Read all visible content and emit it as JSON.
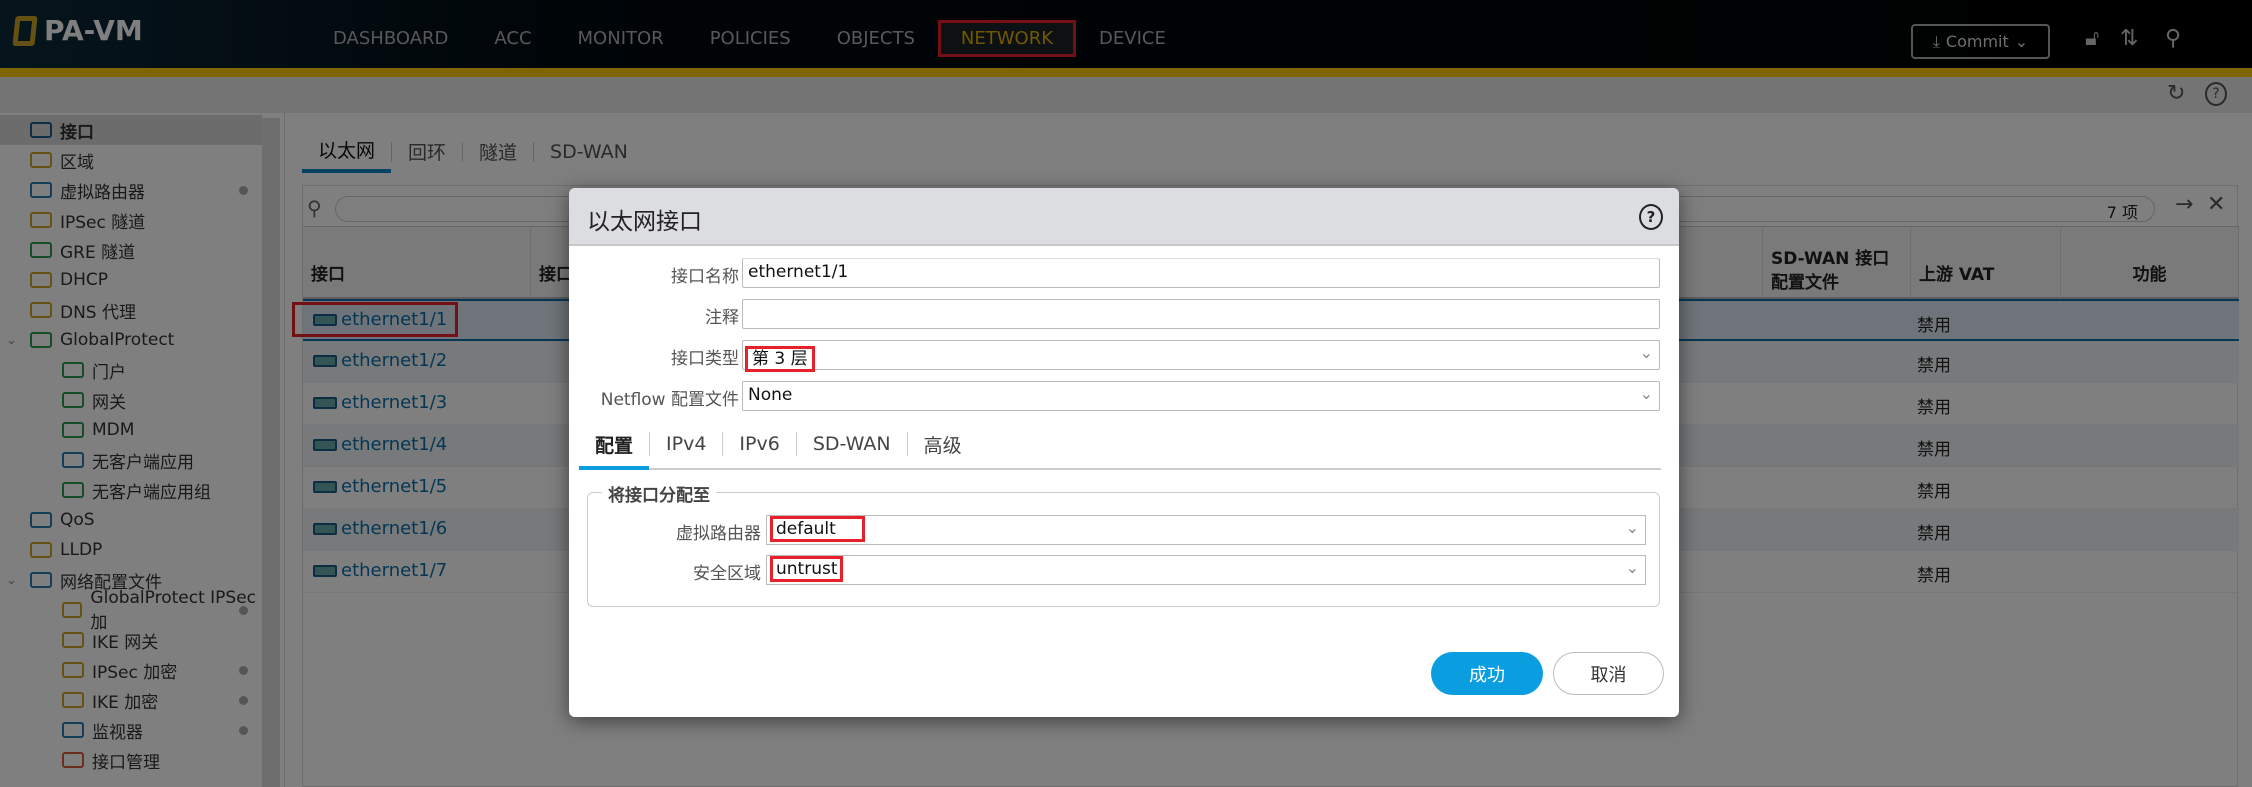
{
  "app": {
    "logo": "PA-VM"
  },
  "nav": [
    "DASHBOARD",
    "ACC",
    "MONITOR",
    "POLICIES",
    "OBJECTS",
    "NETWORK",
    "DEVICE"
  ],
  "nav_active": "NETWORK",
  "header": {
    "commit_label": "Commit"
  },
  "sidebar": {
    "items": [
      {
        "label": "接口",
        "icon": "interface-icon",
        "selected": true
      },
      {
        "label": "区域",
        "icon": "zone-icon"
      },
      {
        "label": "虚拟路由器",
        "icon": "router-icon",
        "dot": true
      },
      {
        "label": "IPSec 隧道",
        "icon": "ipsec-tunnel-icon"
      },
      {
        "label": "GRE 隧道",
        "icon": "gre-tunnel-icon"
      },
      {
        "label": "DHCP",
        "icon": "dhcp-icon"
      },
      {
        "label": "DNS 代理",
        "icon": "dns-proxy-icon"
      },
      {
        "label": "GlobalProtect",
        "icon": "globalprotect-icon",
        "expanded": true
      },
      {
        "label": "门户",
        "icon": "portal-icon",
        "indent": 1
      },
      {
        "label": "网关",
        "icon": "gateway-icon",
        "indent": 1
      },
      {
        "label": "MDM",
        "icon": "mdm-icon",
        "indent": 1
      },
      {
        "label": "无客户端应用",
        "icon": "clientless-app-icon",
        "indent": 1
      },
      {
        "label": "无客户端应用组",
        "icon": "clientless-app-group-icon",
        "indent": 1
      },
      {
        "label": "QoS",
        "icon": "qos-icon"
      },
      {
        "label": "LLDP",
        "icon": "lldp-icon"
      },
      {
        "label": "网络配置文件",
        "icon": "network-profiles-icon",
        "expanded": true
      },
      {
        "label": "GlobalProtect IPSec 加",
        "icon": "lock-icon",
        "indent": 1,
        "dot": true
      },
      {
        "label": "IKE 网关",
        "icon": "ike-gateway-icon",
        "indent": 1
      },
      {
        "label": "IPSec 加密",
        "icon": "lock-icon",
        "indent": 1,
        "dot": true
      },
      {
        "label": "IKE 加密",
        "icon": "lock-icon",
        "indent": 1,
        "dot": true
      },
      {
        "label": "监视器",
        "icon": "monitor-icon",
        "indent": 1,
        "dot": true
      },
      {
        "label": "接口管理",
        "icon": "interface-mgmt-icon",
        "indent": 1
      }
    ]
  },
  "tabs": [
    "以太网",
    "回环",
    "隧道",
    "SD-WAN"
  ],
  "table": {
    "count": "7 项",
    "columns": [
      "接口",
      "接口",
      "SD-WAN 接口配置文件",
      "上游 VAT",
      "功能"
    ],
    "rows": [
      {
        "iface": "ethernet1/1",
        "vat": "禁用"
      },
      {
        "iface": "ethernet1/2",
        "vat": "禁用"
      },
      {
        "iface": "ethernet1/3",
        "vat": "禁用"
      },
      {
        "iface": "ethernet1/4",
        "vat": "禁用"
      },
      {
        "iface": "ethernet1/5",
        "vat": "禁用"
      },
      {
        "iface": "ethernet1/6",
        "vat": "禁用"
      },
      {
        "iface": "ethernet1/7",
        "vat": "禁用"
      }
    ]
  },
  "dialog": {
    "title": "以太网接口",
    "fields": {
      "name_label": "接口名称",
      "name_value": "ethernet1/1",
      "comment_label": "注释",
      "comment_value": "",
      "type_label": "接口类型",
      "type_value": "第 3 层",
      "netflow_label": "Netflow 配置文件",
      "netflow_value": "None"
    },
    "tabs": [
      "配置",
      "IPv4",
      "IPv6",
      "SD-WAN",
      "高级"
    ],
    "assign": {
      "legend": "将接口分配至",
      "vr_label": "虚拟路由器",
      "vr_value": "default",
      "zone_label": "安全区域",
      "zone_value": "untrust"
    },
    "ok_label": "成功",
    "cancel_label": "取消"
  },
  "colors": {
    "accent": "#0a9ee0",
    "brand_gold": "#ffcc00",
    "highlight": "#e8202a"
  }
}
